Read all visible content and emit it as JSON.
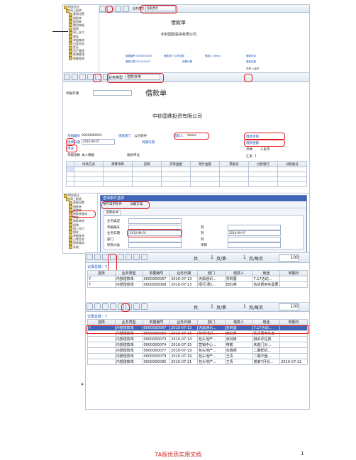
{
  "shot1": {
    "tree": [
      "财务会计",
      "网上报销",
      "基础设置",
      "借款单",
      "报销单",
      "费用单据",
      "报表",
      "网上支付",
      "期末",
      "单据查询",
      "日常业务",
      "凭证",
      "资产管理",
      "账簿管理",
      "预算管理"
    ],
    "doc_type_label": "业务类型",
    "doc_type_value": "借款费用",
    "title": "借款单",
    "company": "中钞国鼎投资有限公司",
    "fields": [
      {
        "label": "单据编号",
        "value": "0000000003"
      },
      {
        "label": "借款部门",
        "value": "公司领导"
      },
      {
        "label": "借款人",
        "value": "demo"
      },
      {
        "label": "借款日期",
        "value": "2010-09-07"
      },
      {
        "label": "到期日期",
        "value": ""
      },
      {
        "label": "借款项目",
        "value": ""
      },
      {
        "label": "借款金额",
        "value": ""
      },
      {
        "label": "币种",
        "value": "人民币"
      }
    ]
  },
  "form": {
    "toolbar_label": "业务类型",
    "toolbar_value": "借款费用",
    "query_label": "单据存储",
    "title": "借款单",
    "company": "中钞国鼎投资有限公司",
    "doc_no_label": "单据编号",
    "doc_no": "0000000003",
    "dept_label": "借款部门",
    "dept": "公司领导",
    "person_label": "借款人",
    "person": "demo",
    "date_label": "借款日期",
    "date": "2010-09-07",
    "due_label": "到期日期",
    "due": "",
    "memo_label": "用途",
    "project_label": "借款项目",
    "amount_label": "借款金额",
    "currency_label": "币种",
    "currency": "人民币",
    "attach_label": "单据张数",
    "attach": "本人填报",
    "receiver_label": "收款单位",
    "rate_label": "汇率",
    "rate": "1",
    "columns": [
      "付款方式",
      "预算项目",
      "说明",
      "实际金额",
      "预计金额",
      "票据号",
      "付款银行",
      "付款账号"
    ]
  },
  "dialog": {
    "title": "查询条件选择",
    "tabs": [
      "保存常用条件",
      "加载方案"
    ],
    "subtab": "常用条件",
    "rows": [
      {
        "label": "业务类型",
        "from": "",
        "to": ""
      },
      {
        "label": "单据编号",
        "from": "",
        "to_label": "到",
        "to": ""
      },
      {
        "label": "业务日期",
        "from": "2010-08-01",
        "to_label": "到",
        "to": "2010-09-07"
      },
      {
        "label": "部门",
        "from": "",
        "to_label": "到",
        "to": ""
      },
      {
        "label": "项目大类",
        "from": "",
        "to_label": "项目",
        "to": ""
      }
    ],
    "ok": "确定",
    "cancel": "取消"
  },
  "list1": {
    "pager": {
      "total_label": "共",
      "pages": "1",
      "page_unit": "页/第",
      "page": "1",
      "per_label": "页/每页",
      "per": "100"
    },
    "records_label": "记录总数：7",
    "columns": [
      "选择",
      "业务类型",
      "单据编号",
      "业务日期",
      "部门",
      "借款人",
      "用途",
      "到期日"
    ],
    "rows": [
      [
        "Y",
        "内部借款单",
        "0000000067",
        "2010-07-13",
        "天鼎通讯...",
        "贾莉蓉",
        "7.17活动...",
        ""
      ],
      [
        "Y",
        "内部借款单",
        "0000000068",
        "2010-07-13",
        "招行(惠)...",
        "田红英",
        "估货费用先需要...",
        ""
      ]
    ]
  },
  "list2": {
    "pager": {
      "total_label": "共",
      "pages": "1",
      "page_unit": "页/第",
      "page": "1",
      "per_label": "页/每页",
      "per": "100"
    },
    "records_label": "记录总数：7",
    "columns": [
      "选择",
      "业务类型",
      "单据编号",
      "业务日期",
      "部门",
      "借款人",
      "用途",
      "到期日"
    ],
    "rows": [
      [
        "Y",
        "内部借款单",
        "0000000067",
        "2010-07-13",
        "天鼎通讯...",
        "贾莉蓉",
        "7.17活动...",
        ""
      ],
      [
        "",
        "内部借款单",
        "0000000069",
        "2010-07-13",
        "特材(包头...",
        "田红英",
        "估货费用先支",
        ""
      ],
      [
        "",
        "内部借款单",
        "0000000073",
        "2010-07-14",
        "包头地产...",
        "张剑锋",
        "融资评估费",
        ""
      ],
      [
        "",
        "内部借款单",
        "0000000074",
        "2010-07-15",
        "营销中心...",
        "蒋鹏",
        "未盘门对...",
        ""
      ],
      [
        "",
        "内部借款单",
        "0000000077",
        "2010-07-19",
        "包头地产...",
        "石春晖",
        "二期样机...",
        ""
      ],
      [
        "",
        "内部借款单",
        "0000000079",
        "2010-07-19",
        "包头地产...",
        "王青",
        "二期平盘...",
        ""
      ],
      [
        "",
        "内部借款单",
        "0000000085",
        "2010-07-21",
        "包头地产...",
        "王青",
        "弟第7月份...",
        "2010-07-22"
      ]
    ]
  },
  "tree2": [
    "财务会计",
    "网上报销",
    "基础设置",
    "借款单",
    "报销单",
    "借款单查询",
    "审批",
    "借款审核",
    "报销",
    "网上支付",
    "期末",
    "单据查询",
    "日常业务",
    "报表查询",
    "系统"
  ],
  "footer": {
    "text": "7A版优质实用文档",
    "page": "1"
  },
  "colors": {
    "accent_red": "#e21d1d",
    "header_blue": "#3f64b8",
    "footer_red": "#d62b2b"
  }
}
